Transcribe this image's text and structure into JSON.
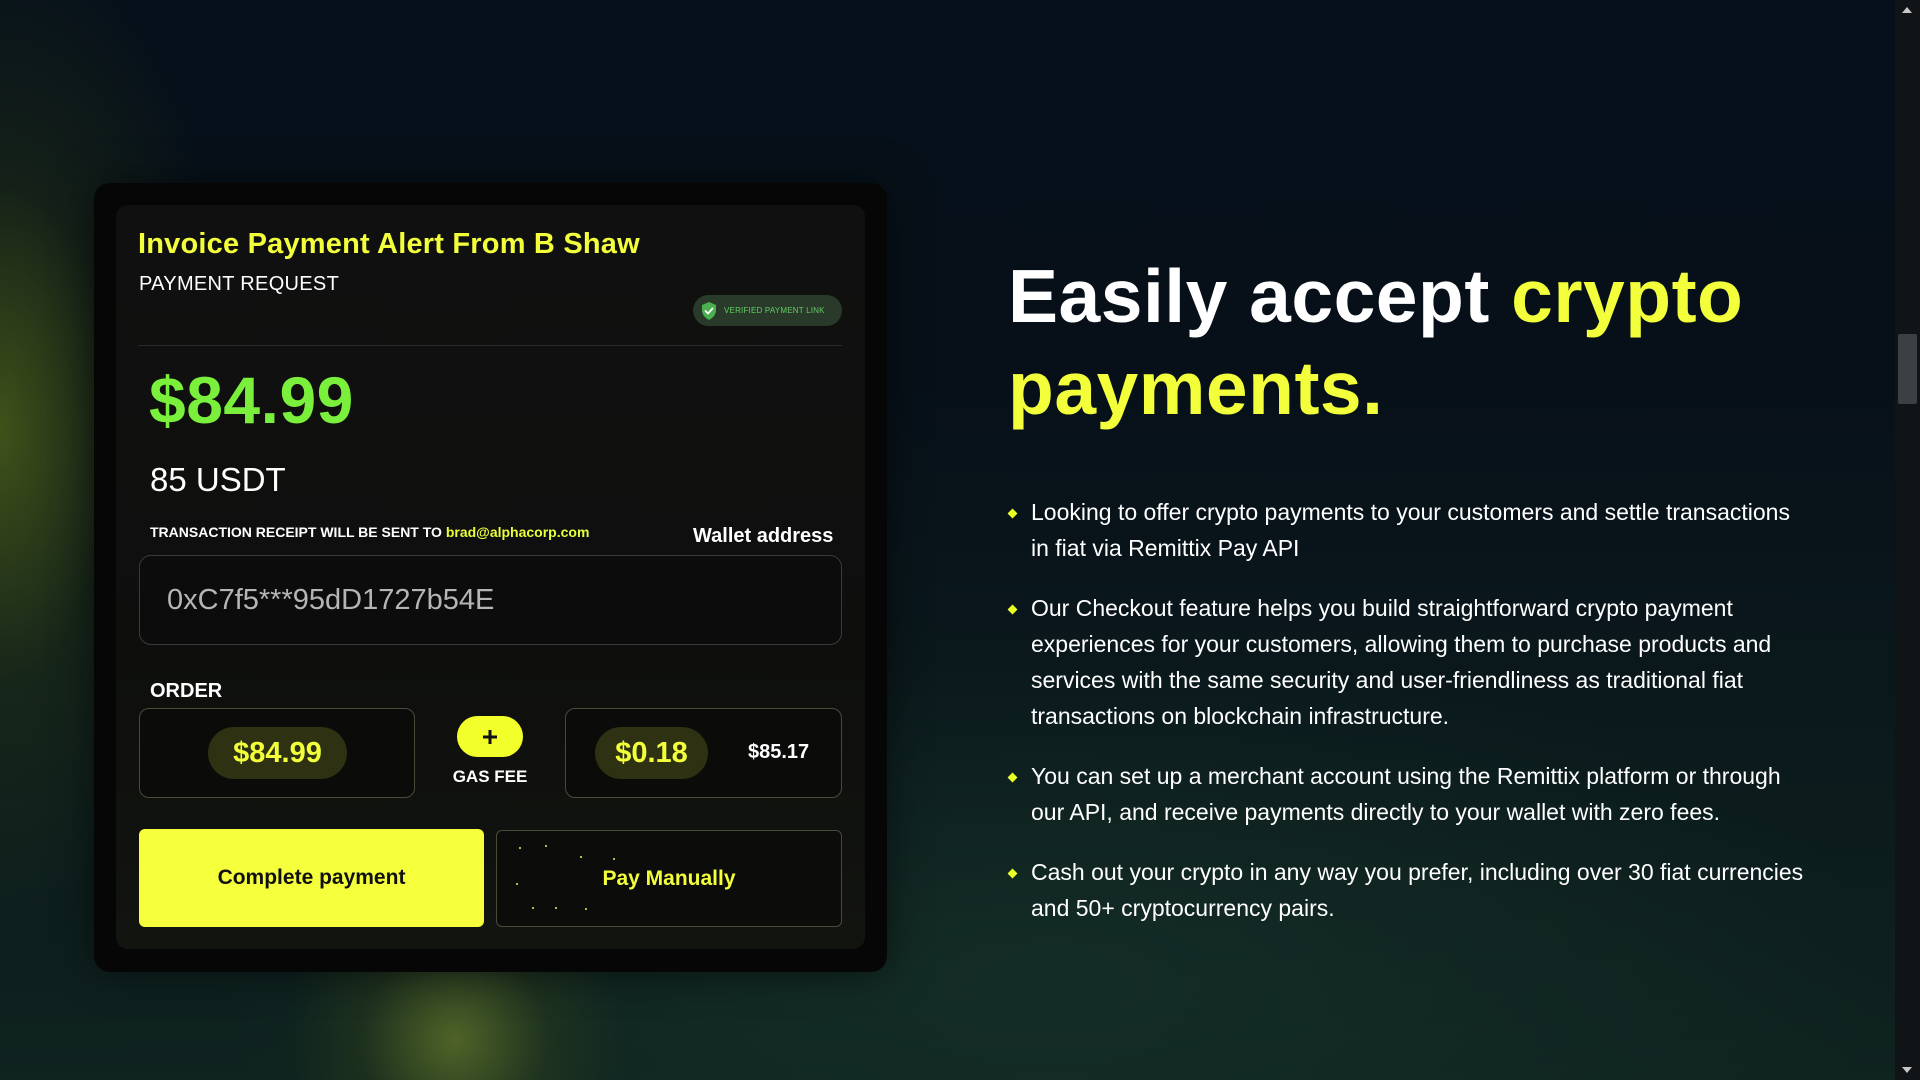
{
  "payment_card": {
    "title": "Invoice Payment Alert From B Shaw",
    "subtitle": "PAYMENT REQUEST",
    "verified_badge": "VERIFIED PAYMENT LINK",
    "amount": "$84.99",
    "crypto_amount": "85 USDT",
    "receipt_prefix": "TRANSACTION RECEIPT WILL BE SENT TO ",
    "receipt_email": "brad@alphacorp.com",
    "wallet_label": "Wallet address",
    "wallet_value": "0xC7f5***95dD1727b54E",
    "order_label": "ORDER",
    "order_amount": "$84.99",
    "plus_symbol": "+",
    "gas_fee_label": "GAS FEE",
    "gas_fee_amount": "$0.18",
    "total_amount": "$85.17",
    "complete_button": "Complete payment",
    "manual_button": "Pay Manually"
  },
  "hero": {
    "headline_plain": "Easily accept ",
    "headline_accent": "crypto payments.",
    "features": [
      "Looking to offer crypto payments to your customers and settle transactions in fiat via Remittix Pay API",
      "Our Checkout feature helps you build straightforward crypto payment experiences for your customers, allowing them to purchase products and services with the same security and user-friendliness as traditional fiat transactions on blockchain infrastructure.",
      "You can set up a merchant account using the Remittix platform or through our API, and receive payments directly to your wallet with zero fees.",
      "Cash out your crypto in any way you prefer, including over 30 fiat currencies and 50+ cryptocurrency pairs."
    ]
  },
  "colors": {
    "accent_yellow": "#f3ff3a",
    "amount_green": "#7bf03c",
    "badge_green": "#5fce5f",
    "background": "#06101a"
  },
  "icons": {
    "verified": "shield-check-icon",
    "bullet": "diamond-bullet-icon"
  }
}
